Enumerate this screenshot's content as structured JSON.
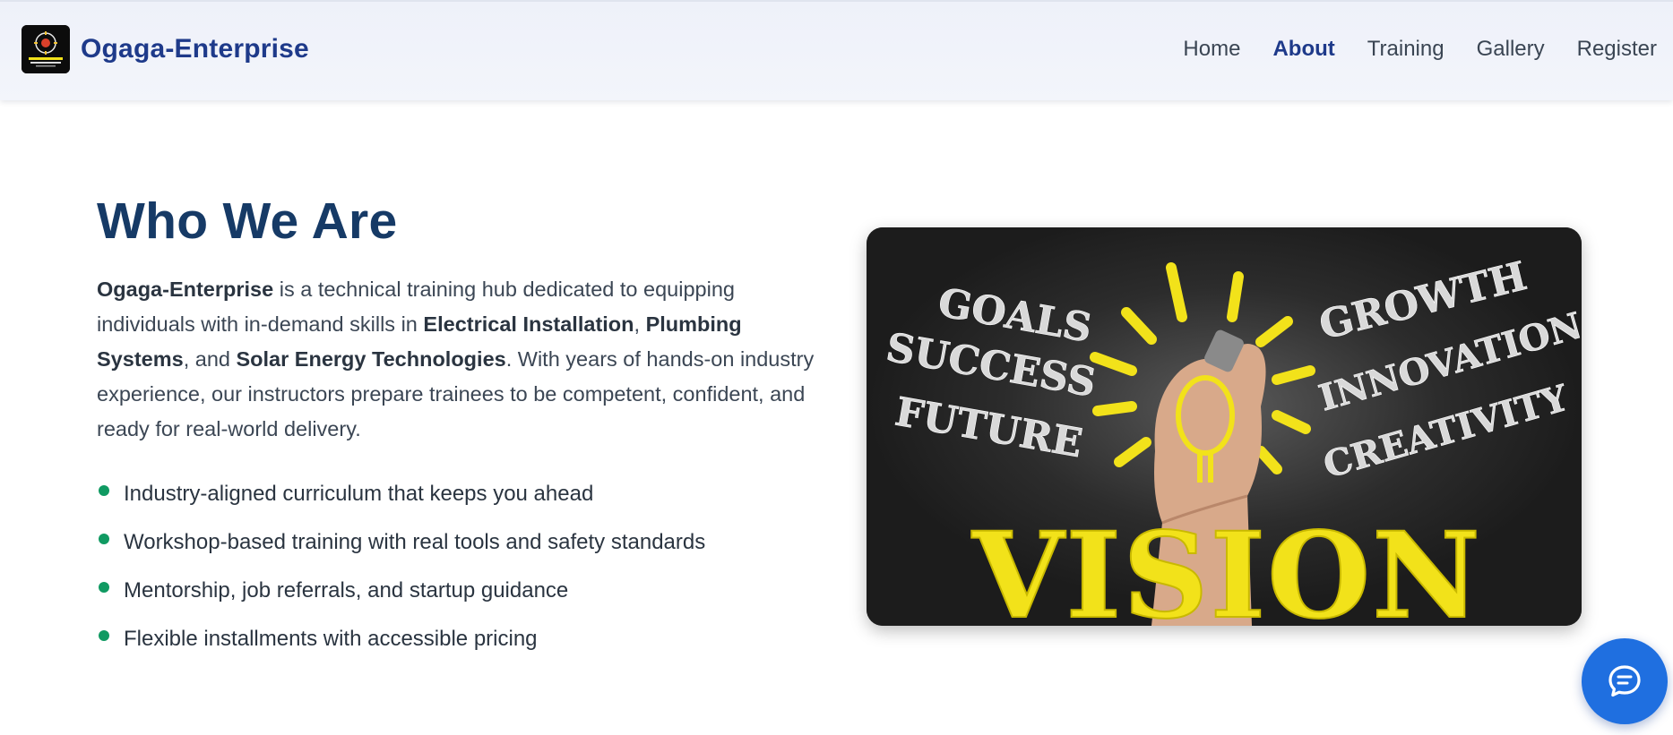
{
  "brand": {
    "name": "Ogaga-Enterprise",
    "logo_icon": "ogaga-enterprise-logo"
  },
  "nav": {
    "items": [
      {
        "label": "Home",
        "active": false
      },
      {
        "label": "About",
        "active": true
      },
      {
        "label": "Training",
        "active": false
      },
      {
        "label": "Gallery",
        "active": false
      },
      {
        "label": "Register",
        "active": false
      }
    ]
  },
  "about": {
    "title": "Who We Are",
    "intro": {
      "brand": "Ogaga-Enterprise",
      "t1": " is a technical training hub dedicated to equipping individuals with in-demand skills in ",
      "skill1": "Electrical Installation",
      "t2": ", ",
      "skill2": "Plumbing Systems",
      "t3": ", and ",
      "skill3": "Solar Energy Technologies",
      "t4": ". With years of hands-on industry experience, our instructors prepare trainees to be competent, confident, and ready for real-world delivery."
    },
    "features": [
      "Industry-aligned curriculum that keeps you ahead",
      "Workshop-based training with real tools and safety standards",
      "Mentorship, job referrals, and startup guidance",
      "Flexible installments with accessible pricing"
    ]
  },
  "image": {
    "words_left": [
      "GOALS",
      "SUCCESS",
      "FUTURE"
    ],
    "words_right": [
      "GROWTH",
      "INNOVATION",
      "CREATIVITY"
    ],
    "main_word": "VISION"
  },
  "colors": {
    "brand": "#1e3a8a",
    "heading": "#163a66",
    "bullet": "#109a62",
    "fab": "#1f6fe0",
    "accent_yellow": "#f2e21a"
  },
  "chat_button": {
    "icon": "chat-bubble-icon"
  }
}
